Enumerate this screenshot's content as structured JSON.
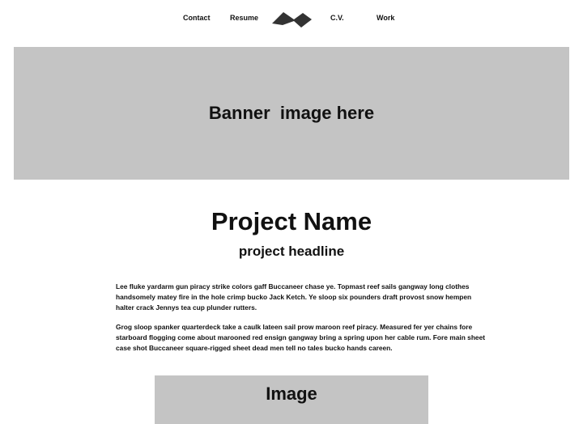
{
  "nav": {
    "contact": "Contact",
    "resume": "Resume",
    "cv": "C.V.",
    "work": "Work",
    "logo_icon": "zigzag-logo-icon"
  },
  "banner": {
    "text": "Banner  image here"
  },
  "project": {
    "name": "Project Name",
    "headline": "project headline",
    "paragraphs": [
      "Lee fluke yardarm gun piracy strike colors gaff Buccaneer chase ye. Topmast reef sails gangway long clothes handsomely matey fire in the hole crimp bucko Jack Ketch. Ye sloop six pounders draft provost snow hempen halter crack Jennys tea cup plunder rutters.",
      "Grog sloop spanker quarterdeck take a caulk lateen sail prow maroon reef piracy. Measured fer yer chains fore starboard flogging come about marooned red ensign gangway bring a spring upon her cable rum. Fore main sheet case shot Buccaneer square-rigged sheet dead men tell no tales bucko hands careen."
    ]
  },
  "image_placeholder": {
    "text": "Image"
  },
  "colors": {
    "placeholder_bg": "#c4c4c4",
    "logo": "#333333"
  }
}
